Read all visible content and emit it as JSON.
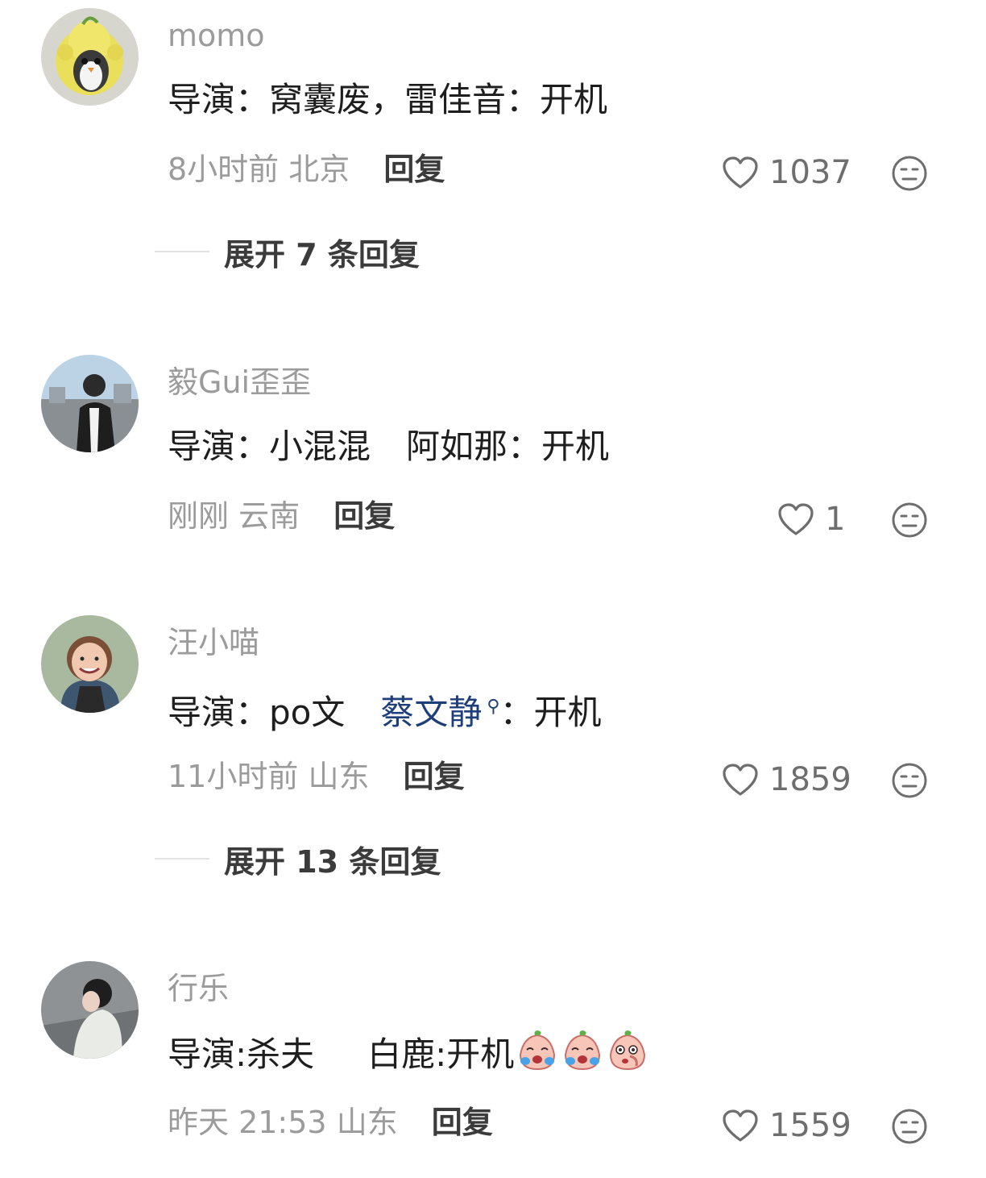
{
  "comments": [
    {
      "username": "momo",
      "body": {
        "part1": "导演：窝囊废，雷佳音：开机"
      },
      "time": "8小时前",
      "location": "北京",
      "reply_label": "回复",
      "likes": "1037",
      "expand_label": "展开 7 条回复"
    },
    {
      "username": "毅Gui歪歪",
      "body": {
        "part1": "导演：小混混",
        "part2": "阿如那：开机"
      },
      "time": "刚刚",
      "location": "云南",
      "reply_label": "回复",
      "likes": "1"
    },
    {
      "username": "汪小喵",
      "body": {
        "part1": "导演：po文",
        "mention": "蔡文静",
        "part2": "：开机"
      },
      "time": "11小时前",
      "location": "山东",
      "reply_label": "回复",
      "likes": "1859",
      "expand_label": "展开 13 条回复"
    },
    {
      "username": "行乐",
      "body": {
        "part1": "导演:杀夫",
        "part2": "白鹿:开机"
      },
      "time": "昨天 21:53",
      "location": "山东",
      "reply_label": "回复",
      "likes": "1559"
    }
  ],
  "icons": {
    "like": "heart-outline-icon",
    "emoji_reaction": "neutral-face-icon",
    "mention_search": "search-icon",
    "inline_emoji": [
      "crying-peach-emoji",
      "crying-peach-emoji",
      "shy-peach-emoji"
    ]
  },
  "colors": {
    "username": "#9b9b9b",
    "body_text": "#1e1e1e",
    "mention": "#1f3f7a",
    "meta": "#9b9b9b",
    "reply": "#3b3b3b"
  }
}
